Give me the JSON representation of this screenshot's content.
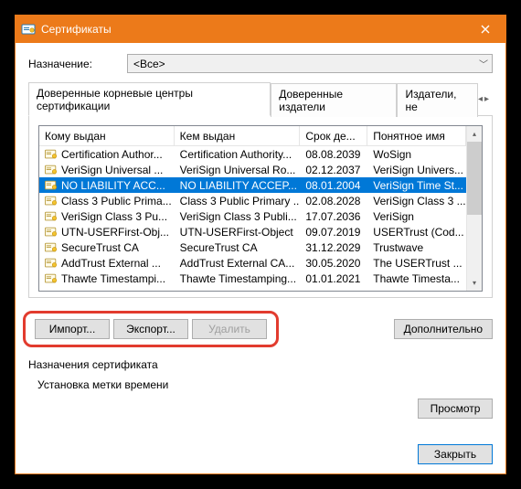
{
  "window": {
    "title": "Сертификаты"
  },
  "purpose": {
    "label": "Назначение:",
    "value": "<Все>"
  },
  "tabs": {
    "active": "Доверенные корневые центры сертификации",
    "t1": "Доверенные издатели",
    "t2": "Издатели, не"
  },
  "columns": {
    "c0": "Кому выдан",
    "c1": "Кем выдан",
    "c2": "Срок де...",
    "c3": "Понятное имя"
  },
  "rows": [
    {
      "issued_to": "Certification Author...",
      "issued_by": "Certification Authority...",
      "exp": "08.08.2039",
      "name": "WoSign",
      "sel": false
    },
    {
      "issued_to": "VeriSign Universal ...",
      "issued_by": "VeriSign Universal Ro...",
      "exp": "02.12.2037",
      "name": "VeriSign Univers...",
      "sel": false
    },
    {
      "issued_to": "NO LIABILITY ACC...",
      "issued_by": "NO LIABILITY ACCEP...",
      "exp": "08.01.2004",
      "name": "VeriSign Time St...",
      "sel": true
    },
    {
      "issued_to": "Class 3 Public Prima...",
      "issued_by": "Class 3 Public Primary ...",
      "exp": "02.08.2028",
      "name": "VeriSign Class 3 ...",
      "sel": false
    },
    {
      "issued_to": "VeriSign Class 3 Pu...",
      "issued_by": "VeriSign Class 3 Publi...",
      "exp": "17.07.2036",
      "name": "VeriSign",
      "sel": false
    },
    {
      "issued_to": "UTN-USERFirst-Obj...",
      "issued_by": "UTN-USERFirst-Object",
      "exp": "09.07.2019",
      "name": "USERTrust (Cod...",
      "sel": false
    },
    {
      "issued_to": "SecureTrust CA",
      "issued_by": "SecureTrust CA",
      "exp": "31.12.2029",
      "name": "Trustwave",
      "sel": false
    },
    {
      "issued_to": "AddTrust External ...",
      "issued_by": "AddTrust External CA...",
      "exp": "30.05.2020",
      "name": "The USERTrust ...",
      "sel": false
    },
    {
      "issued_to": "Thawte Timestampi...",
      "issued_by": "Thawte Timestamping...",
      "exp": "01.01.2021",
      "name": "Thawte Timesta...",
      "sel": false
    }
  ],
  "buttons": {
    "import": "Импорт...",
    "export": "Экспорт...",
    "delete": "Удалить",
    "advanced": "Дополнительно",
    "view": "Просмотр",
    "close": "Закрыть"
  },
  "labels": {
    "cert_purposes": "Назначения сертификата",
    "purpose_text": "Установка метки времени"
  }
}
